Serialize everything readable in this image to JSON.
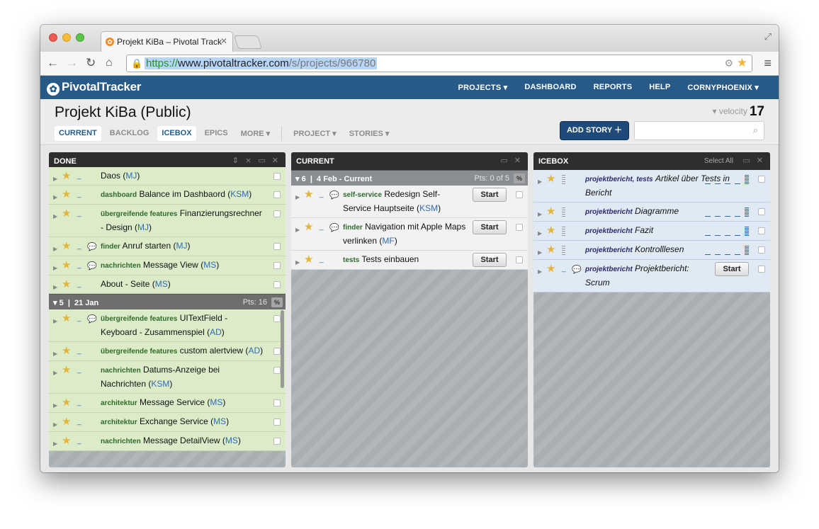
{
  "browser": {
    "tab_title": "Projekt KiBa – Pivotal Track",
    "url_proto": "https://",
    "url_host": "www.pivotaltracker.com",
    "url_path": "/s/projects/966780"
  },
  "header": {
    "logo": "PivotalTracker",
    "nav": [
      "PROJECTS ▾",
      "DASHBOARD",
      "REPORTS",
      "HELP",
      "CORNYPHOENIX ▾"
    ]
  },
  "project": {
    "title": "Projekt KiBa (Public)",
    "velocity_label": "▾ velocity",
    "velocity_value": "17",
    "tabs": [
      "CURRENT",
      "BACKLOG",
      "ICEBOX",
      "EPICS",
      "MORE ▾"
    ],
    "menus": [
      "PROJECT ▾",
      "STORIES ▾"
    ],
    "add_story": "ADD STORY ＋"
  },
  "panels": {
    "done": {
      "title": "DONE",
      "stories_top": [
        {
          "label": "",
          "title": "Daos",
          "owner": "MJ"
        },
        {
          "label": "dashboard",
          "title": "Balance im Dashbaord",
          "owner": "KSM"
        },
        {
          "label": "übergreifende features",
          "title": "Finanzierungsrechner - Design",
          "owner": "MJ"
        },
        {
          "label": "finder",
          "title": "Anruf starten",
          "owner": "MJ"
        },
        {
          "label": "nachrichten",
          "title": "Message View",
          "owner": "MS"
        },
        {
          "label": "",
          "title": "About - Seite",
          "owner": "MS"
        }
      ],
      "iteration": {
        "number": "5",
        "date": "21 Jan",
        "points": "Pts: 16",
        "pct": "%"
      },
      "stories_bottom": [
        {
          "label": "übergreifende features",
          "title": "UITextField - Keyboard - Zusammenspiel",
          "owner": "AD"
        },
        {
          "label": "übergreifende features",
          "title": "custom alertview",
          "owner": "AD"
        },
        {
          "label": "nachrichten",
          "title": "Datums-Anzeige bei Nachrichten",
          "owner": "KSM"
        },
        {
          "label": "architektur",
          "title": "Message Service",
          "owner": "MS"
        },
        {
          "label": "architektur",
          "title": "Exchange Service",
          "owner": "MS"
        },
        {
          "label": "nachrichten",
          "title": "Message DetailView",
          "owner": "MS"
        }
      ]
    },
    "current": {
      "title": "CURRENT",
      "iteration": {
        "number": "6",
        "date": "4 Feb - Current",
        "points": "Pts: 0 of 5",
        "pct": "%"
      },
      "stories": [
        {
          "label": "self-service",
          "title": "Redesign Self-Service Hauptseite",
          "owner": "KSM",
          "button": "Start"
        },
        {
          "label": "finder",
          "title": "Navigation mit Apple Maps verlinken",
          "owner": "MF",
          "button": "Start"
        },
        {
          "label": "tests",
          "title": "Tests einbauen",
          "owner": "",
          "button": "Start"
        }
      ]
    },
    "icebox": {
      "title": "ICEBOX",
      "select_all": "Select All",
      "stories": [
        {
          "label": "projektbericht, tests",
          "title": "Artikel über Tests in Bericht"
        },
        {
          "label": "projektbericht",
          "title": "Diagramme"
        },
        {
          "label": "projektbericht",
          "title": "Fazit"
        },
        {
          "label": "projektbericht",
          "title": "Kontrolllesen"
        },
        {
          "label": "projektbericht",
          "title": "Projektbericht: Scrum",
          "button": "Start"
        }
      ]
    }
  }
}
